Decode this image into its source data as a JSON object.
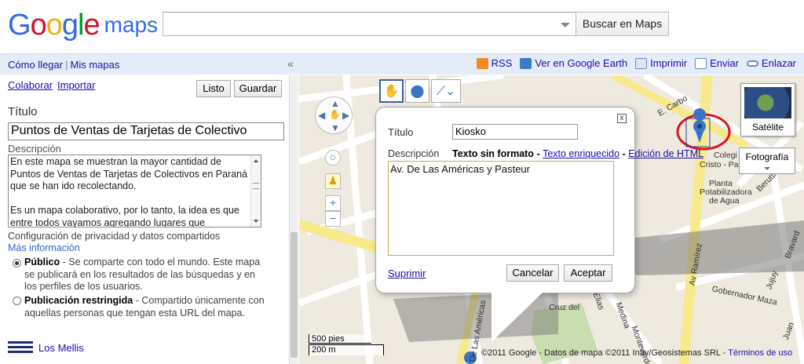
{
  "header": {
    "logo": {
      "part1": "Google",
      "part2": "maps"
    },
    "search": {
      "value": "",
      "button_label": "Buscar en Maps"
    }
  },
  "topbar": {
    "left_links": [
      "Cómo llegar",
      "Mis mapas"
    ],
    "collapse_glyph": "«",
    "toolbar": [
      {
        "label": "RSS",
        "icon": "rss-icon",
        "color": "#f08a24"
      },
      {
        "label": "Ver en Google Earth",
        "icon": "earth-icon",
        "color": "#3a7ac8"
      },
      {
        "label": "Imprimir",
        "icon": "print-icon",
        "color": "#6a8cc0"
      },
      {
        "label": "Enviar",
        "icon": "mail-icon",
        "color": "#6a8cc0"
      },
      {
        "label": "Enlazar",
        "icon": "link-icon",
        "color": "#6a8cc0"
      }
    ]
  },
  "panel": {
    "colaborar": "Colaborar",
    "importar": "Importar",
    "listo": "Listo",
    "guardar": "Guardar",
    "titulo_label": "Título",
    "titulo_value": "Puntos de Ventas de Tarjetas de Colectivo",
    "descripcion_label": "Descripción",
    "descripcion_text": "En este mapa se muestran la mayor cantidad de Puntos de Ventas de Tarjetas de Colectivos en Paraná que se han ido recolectando.\n\nEs un mapa colaborativo, por lo tanto, la idea es que entre todos vayamos agregando lugares que",
    "privacy_label": "Configuración de privacidad y datos compartidos",
    "mas_info": "Más información",
    "options": [
      {
        "title": "Público",
        "text": " - Se comparte con todo el mundo. Este mapa se publicará en los resultados de las búsquedas y en los perfiles de los usuarios.",
        "selected": true
      },
      {
        "title": "Publicación restringida",
        "text": " - Compartido únicamente con aquellas personas que tengan esta URL del mapa.",
        "selected": false
      }
    ],
    "layer_name": "Los Mellis"
  },
  "map": {
    "satellite_label": "Satélite",
    "foto_label": "Fotografía",
    "scale": {
      "top": "500 pies",
      "bottom": "200 m"
    },
    "copyright": "©2011 Google - Datos de mapa ©2011 Inav/Geosistemas SRL - ",
    "terms": "Términos de uso",
    "streets": [
      "E. Carbo",
      "Av Ramírez",
      "Gobernador Maza",
      "Cruz del",
      "Medina",
      "Elias",
      "Monteverde",
      "De Las Américas",
      "Colegi",
      "Cristo - Parr",
      "Planta",
      "Potabilizadora",
      "de Agua",
      "Jujuy",
      "Berutti",
      "Bravard",
      "Juan"
    ],
    "popup": {
      "titulo_label": "Título",
      "titulo_value": "Kiosko",
      "descripcion_label": "Descripción",
      "mode_plain": "Texto sin formato",
      "mode_rich": "Texto enriquecido",
      "mode_html": "Edición de HTML",
      "descripcion_value": "Av. De Las Américas y Pasteur",
      "suprimir": "Suprimir",
      "cancelar": "Cancelar",
      "aceptar": "Aceptar",
      "close_glyph": "x"
    }
  }
}
